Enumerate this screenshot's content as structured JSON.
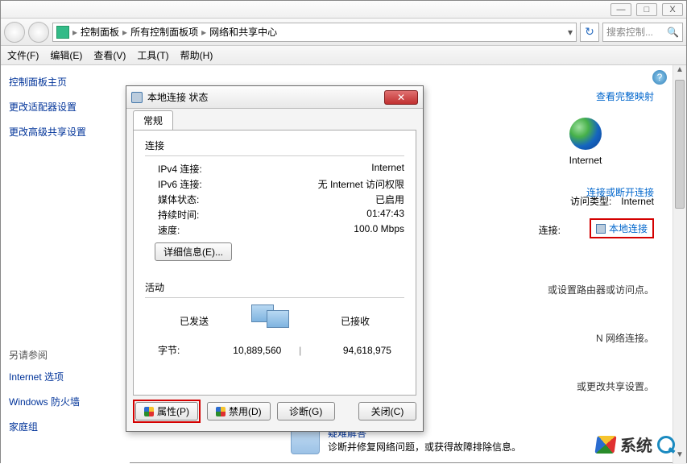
{
  "window": {
    "min": "—",
    "max": "□",
    "close": "X"
  },
  "breadcrumb": {
    "items": [
      "控制面板",
      "所有控制面板项",
      "网络和共享中心"
    ]
  },
  "search": {
    "placeholder": "搜索控制..."
  },
  "menubar": {
    "items": [
      "文件(F)",
      "编辑(E)",
      "查看(V)",
      "工具(T)",
      "帮助(H)"
    ]
  },
  "sidebar": {
    "heading": "控制面板主页",
    "links": [
      "更改适配器设置",
      "更改高级共享设置"
    ],
    "see_also_head": "另请参阅",
    "see_also": [
      "Internet 选项",
      "Windows 防火墙",
      "家庭组"
    ]
  },
  "netmap": {
    "full_map_link": "查看完整映射",
    "internet_label": "Internet",
    "connect_link": "连接或断开连接"
  },
  "info": {
    "access_label": "访问类型:",
    "access_value": "Internet",
    "conn_label": "连接:",
    "conn_value": "本地连接"
  },
  "bodytext": {
    "t1": "或设置路由器或访问点。",
    "t2": "N 网络连接。",
    "t3": "或更改共享设置。"
  },
  "troubleshoot": {
    "head": "疑难解答",
    "desc": "诊断并修复网络问题，或获得故障排除信息。"
  },
  "dialog": {
    "title": "本地连接 状态",
    "tab": "常规",
    "group_conn": "连接",
    "rows": {
      "ipv4_l": "IPv4 连接:",
      "ipv4_v": "Internet",
      "ipv6_l": "IPv6 连接:",
      "ipv6_v": "无 Internet 访问权限",
      "media_l": "媒体状态:",
      "media_v": "已启用",
      "dur_l": "持续时间:",
      "dur_v": "01:47:43",
      "speed_l": "速度:",
      "speed_v": "100.0 Mbps"
    },
    "details_btn": "详细信息(E)...",
    "group_act": "活动",
    "sent_l": "已发送",
    "recv_l": "已接收",
    "bytes_l": "字节:",
    "sent_v": "10,889,560",
    "recv_v": "94,618,975",
    "btn_props": "属性(P)",
    "btn_disable": "禁用(D)",
    "btn_diag": "诊断(G)",
    "btn_close": "关闭(C)"
  },
  "watermark": {
    "text": "系统"
  }
}
